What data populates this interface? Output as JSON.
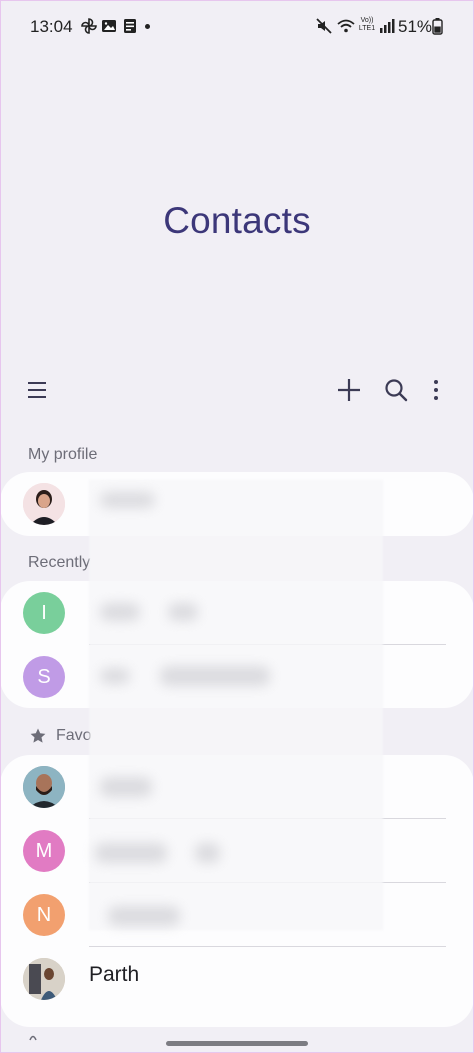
{
  "status_bar": {
    "time": "13:04",
    "battery_percent": "51%",
    "network_label": "Vo)) LTE1"
  },
  "header": {
    "title": "Contacts"
  },
  "toolbar": {
    "menu_icon": "hamburger-icon",
    "add_icon": "plus-icon",
    "search_icon": "search-icon",
    "more_icon": "more-vert-icon"
  },
  "sections": {
    "my_profile": "My profile",
    "recently": "Recently",
    "favorites": "Favo"
  },
  "recent_contacts": [
    {
      "initial": "I",
      "color": "#79cf9b"
    },
    {
      "initial": "S",
      "color": "#c09be6"
    }
  ],
  "favorite_contacts": [
    {
      "initial": "",
      "name": ""
    },
    {
      "initial": "M",
      "color": "#e17bc3",
      "name": ""
    },
    {
      "initial": "N",
      "color": "#f2a06f",
      "name": ""
    },
    {
      "initial": "",
      "name": "Parth"
    }
  ],
  "colors": {
    "background": "#f1eff5",
    "title": "#3c3779",
    "card": "#fdfdfe"
  }
}
